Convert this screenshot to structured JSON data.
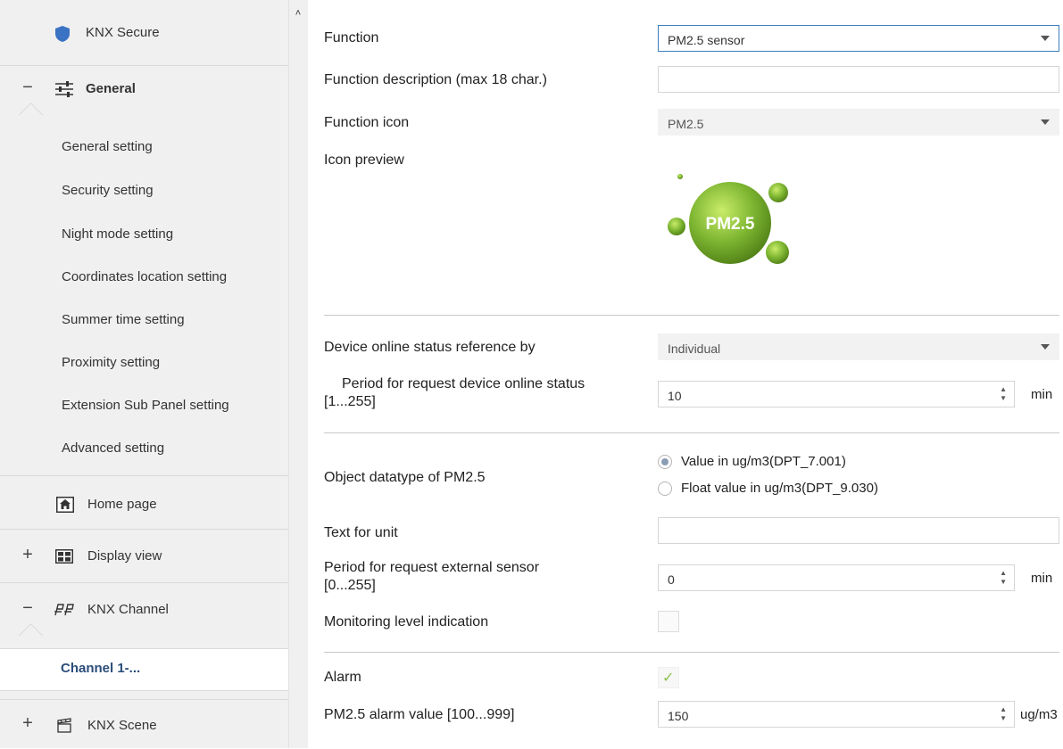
{
  "sidebar": {
    "knx_secure": "KNX Secure",
    "general": {
      "expander": "−",
      "label": "General"
    },
    "general_items": [
      "General setting",
      "Security setting",
      "Night mode setting",
      "Coordinates location setting",
      "Summer time setting",
      "Proximity setting",
      "Extension Sub Panel setting",
      "Advanced setting"
    ],
    "home_page": "Home page",
    "display_view": {
      "expander": "+",
      "label": "Display view"
    },
    "knx_channel": {
      "expander": "−",
      "label": "KNX Channel"
    },
    "channel_1": "Channel 1-...",
    "knx_scene": {
      "expander": "+",
      "label": "KNX Scene"
    }
  },
  "scroll_up_glyph": "˄",
  "form": {
    "function": {
      "label": "Function",
      "value": "PM2.5 sensor"
    },
    "function_description": {
      "label": "Function description (max 18 char.)",
      "value": ""
    },
    "function_icon": {
      "label": "Function icon",
      "value": "PM2.5"
    },
    "icon_preview": {
      "label": "Icon preview",
      "icon_text": "PM2.5"
    },
    "device_online_status": {
      "label": "Device online status reference by",
      "value": "Individual"
    },
    "period_online_status": {
      "label_line1": "Period for request device online status",
      "label_line2": "[1...255]",
      "value": "10",
      "unit": "min"
    },
    "object_datatype": {
      "label": "Object datatype of PM2.5",
      "options": [
        "Value in ug/m3(DPT_7.001)",
        "Float value in ug/m3(DPT_9.030)"
      ],
      "selected_index": 0
    },
    "text_for_unit": {
      "label": "Text for unit",
      "value": ""
    },
    "period_external_sensor": {
      "label_line1": "Period for request external sensor",
      "label_line2": "[0...255]",
      "value": "0",
      "unit": "min"
    },
    "monitoring_level": {
      "label": "Monitoring level indication",
      "checked": false
    },
    "alarm": {
      "label": "Alarm",
      "checked": true,
      "check_glyph": "✓"
    },
    "pm25_alarm_value": {
      "label": "PM2.5 alarm value [100...999]",
      "value": "150",
      "unit": "ug/m3"
    }
  },
  "colors": {
    "sidebar_bg": "#f0f0f0",
    "active_text": "#2a4d7a",
    "shield": "#3b73c4",
    "check": "#8bc34a",
    "orb": "#7db531",
    "focus_border": "#3c7fc0"
  },
  "spinner_glyph": {
    "up": "▲",
    "down": "▼"
  }
}
